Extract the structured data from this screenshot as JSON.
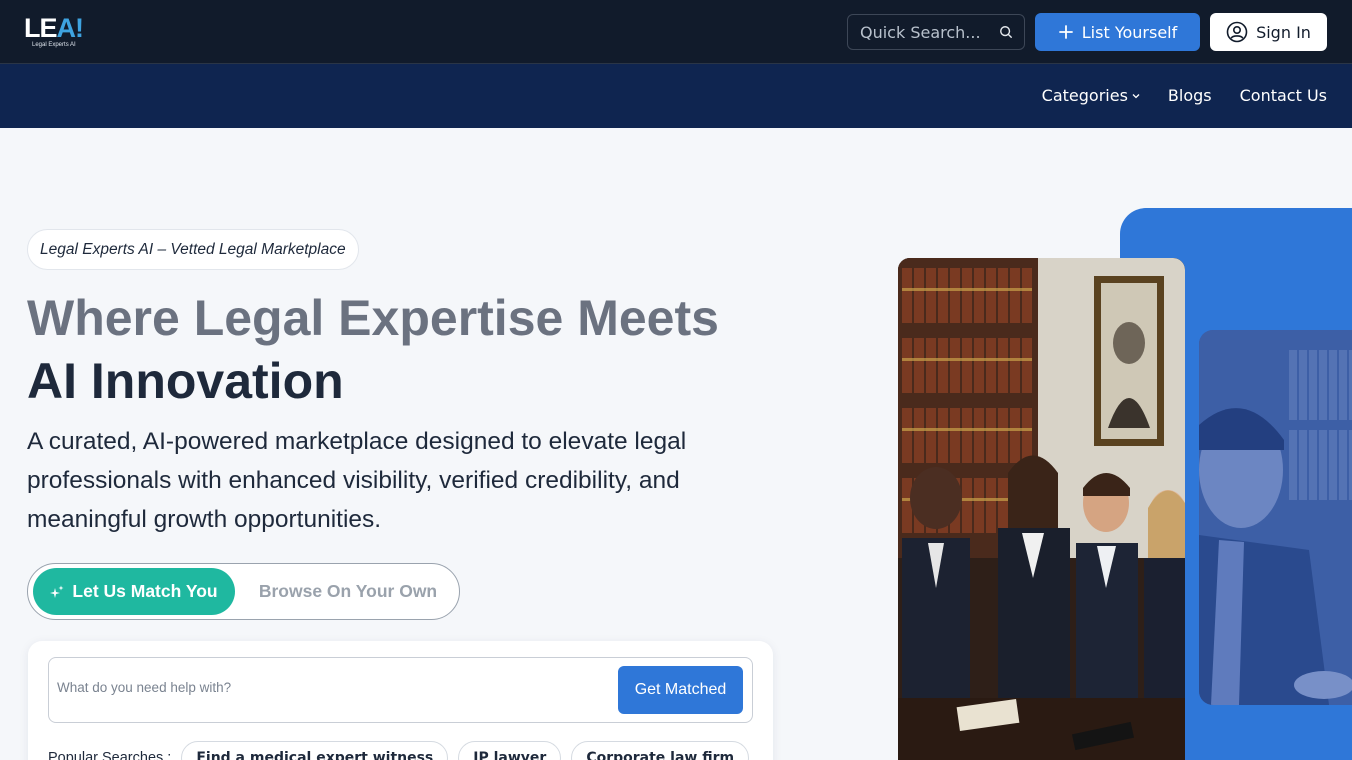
{
  "header": {
    "logo_text": "LEA!",
    "logo_tagline": "Legal Experts AI",
    "search_placeholder": "Quick Search...",
    "list_button": "List Yourself",
    "signin_button": "Sign In"
  },
  "nav": {
    "items": [
      "Categories",
      "Blogs",
      "Contact Us"
    ]
  },
  "hero": {
    "badge": "Legal Experts AI – Vetted Legal Marketplace",
    "headline_light": "Where Legal Expertise Meets",
    "headline_bold": "AI Innovation",
    "subcopy": "A curated, AI-powered marketplace designed to elevate legal professionals with enhanced visibility, verified credibility, and meaningful growth opportunities."
  },
  "toggle": {
    "active": "Let Us Match You",
    "inactive": "Browse On Your Own"
  },
  "search_card": {
    "placeholder": "What do you need help with?",
    "button": "Get Matched",
    "popular_label": "Popular Searches :",
    "chips": [
      "Find a medical expert witness",
      "IP lawyer",
      "Corporate law firm"
    ]
  },
  "colors": {
    "topbar": "#111b2b",
    "navbar": "#0f2550",
    "primary_blue": "#2f77d8",
    "teal": "#1fb8a0"
  }
}
